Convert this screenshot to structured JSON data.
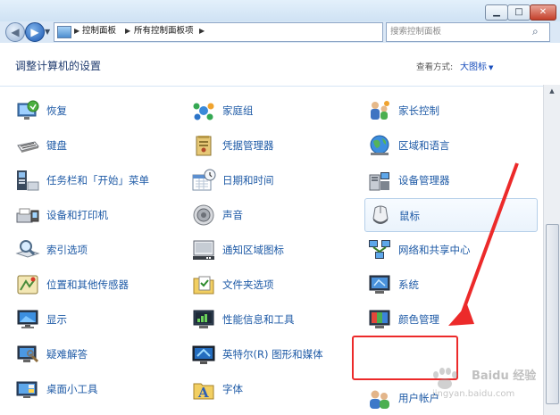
{
  "window": {
    "min_icon": "minimize-icon",
    "max_icon": "maximize-icon",
    "close_icon": "close-icon"
  },
  "address_bar": {
    "crumbs": [
      "控制面板",
      "所有控制面板项"
    ],
    "search_placeholder": "搜索控制面板"
  },
  "header": {
    "title": "调整计算机的设置",
    "view_label": "查看方式:",
    "view_value": "大图标"
  },
  "items": {
    "col1": [
      "恢复",
      "键盘",
      "任务栏和「开始」菜单",
      "设备和打印机",
      "索引选项",
      "位置和其他传感器",
      "显示",
      "疑难解答",
      "桌面小工具"
    ],
    "col2": [
      "家庭组",
      "凭据管理器",
      "日期和时间",
      "声音",
      "通知区域图标",
      "文件夹选项",
      "性能信息和工具",
      "英特尔(R) 图形和媒体",
      "字体"
    ],
    "col3": [
      "家长控制",
      "区域和语言",
      "设备管理器",
      "鼠标",
      "网络和共享中心",
      "系统",
      "颜色管理",
      "用户帐户"
    ]
  },
  "highlight": {
    "color": "#ec2a2a",
    "target": "用户帐户"
  },
  "watermark": {
    "line1": "Baidu 经验",
    "line2": "jingyan.baidu.com"
  }
}
